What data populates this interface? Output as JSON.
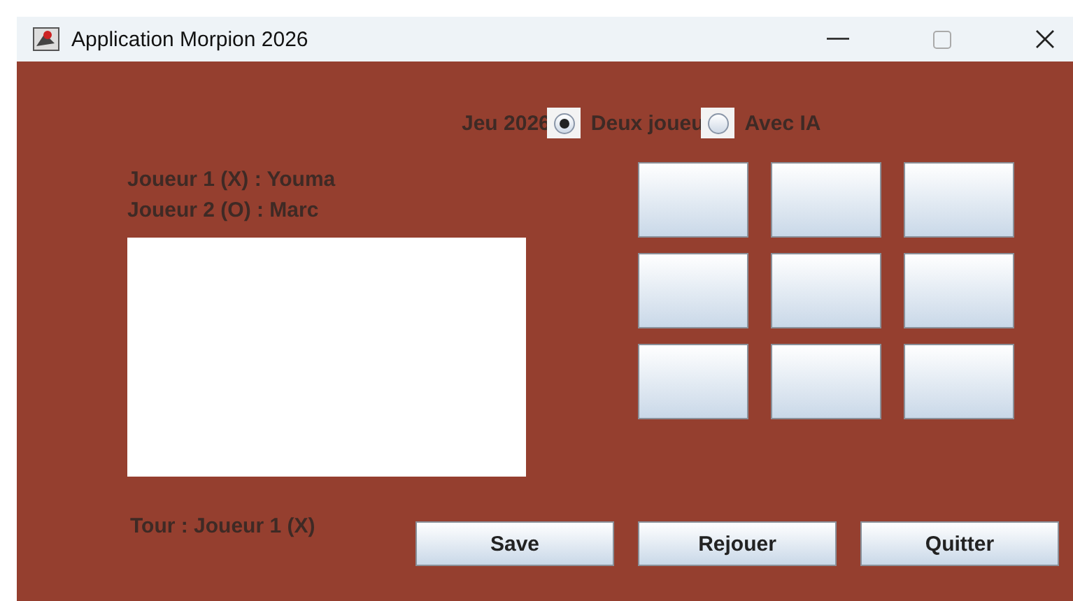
{
  "window": {
    "title": "Application Morpion 2026"
  },
  "mode": {
    "label": "Jeu 2026",
    "options": [
      {
        "label": "Deux joueu",
        "selected": true
      },
      {
        "label": "Avec IA",
        "selected": false
      }
    ]
  },
  "players": [
    "Joueur 1 (X) : Youma",
    "Joueur 2 (O) : Marc"
  ],
  "turn": "Tour : Joueur 1 (X)",
  "buttons": [
    "Save",
    "Rejouer",
    "Quitter"
  ]
}
